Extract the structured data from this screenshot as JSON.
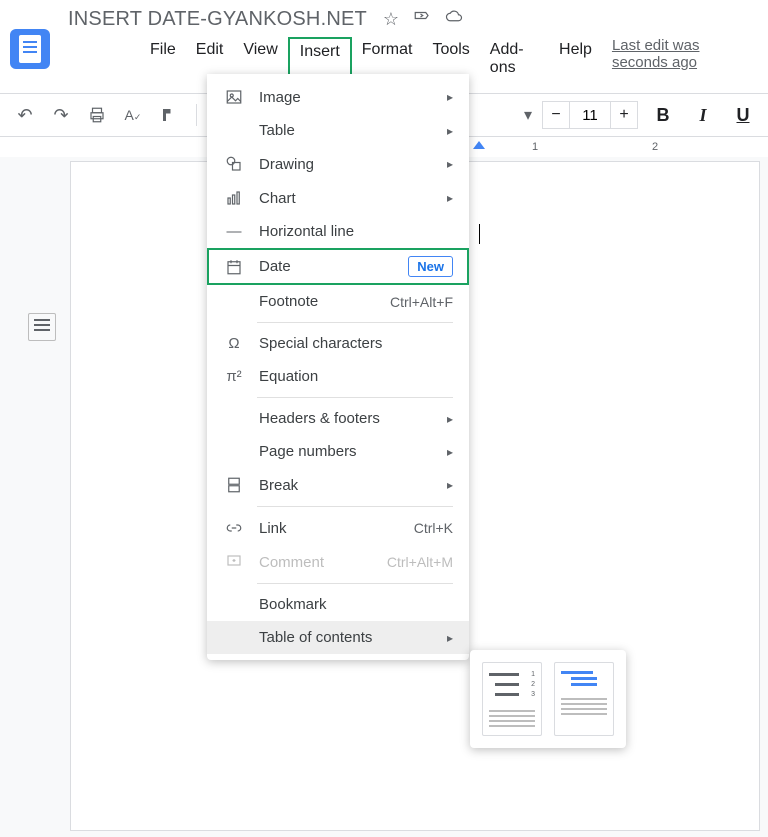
{
  "header": {
    "title": "INSERT DATE-GYANKOSH.NET",
    "last_edit": "Last edit was seconds ago"
  },
  "menu": {
    "file": "File",
    "edit": "Edit",
    "view": "View",
    "insert": "Insert",
    "format": "Format",
    "tools": "Tools",
    "addons": "Add-ons",
    "help": "Help"
  },
  "toolbar": {
    "font_size": "11"
  },
  "dropdown": {
    "image": "Image",
    "table": "Table",
    "drawing": "Drawing",
    "chart": "Chart",
    "hr": "Horizontal line",
    "date": "Date",
    "date_badge": "New",
    "footnote": "Footnote",
    "footnote_sc": "Ctrl+Alt+F",
    "special": "Special characters",
    "equation": "Equation",
    "headers": "Headers & footers",
    "pagenum": "Page numbers",
    "break": "Break",
    "link": "Link",
    "link_sc": "Ctrl+K",
    "comment": "Comment",
    "comment_sc": "Ctrl+Alt+M",
    "bookmark": "Bookmark",
    "toc": "Table of contents"
  },
  "ruler": {
    "t1": "1",
    "t2": "2"
  }
}
